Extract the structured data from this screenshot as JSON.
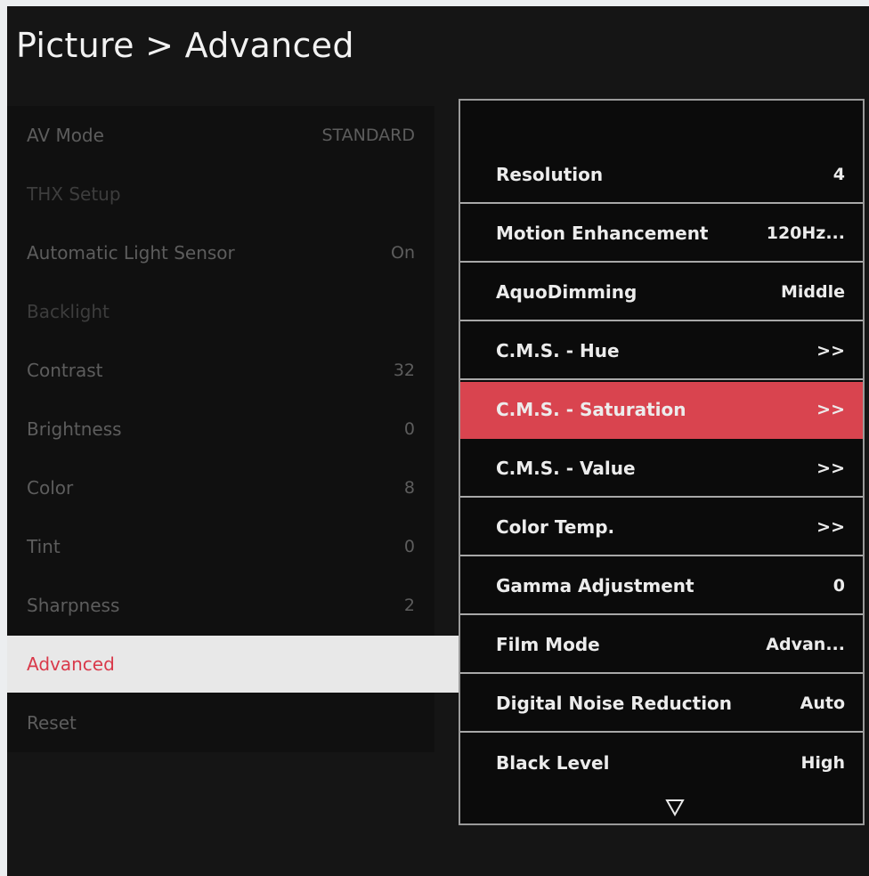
{
  "title": "Picture > Advanced",
  "left_menu": [
    {
      "label": "AV Mode",
      "value": "STANDARD"
    },
    {
      "label": "THX Setup",
      "value": ""
    },
    {
      "label": "Automatic Light Sensor",
      "value": "On"
    },
    {
      "label": "Backlight",
      "value": ""
    },
    {
      "label": "Contrast",
      "value": "32"
    },
    {
      "label": "Brightness",
      "value": "0"
    },
    {
      "label": "Color",
      "value": "8"
    },
    {
      "label": "Tint",
      "value": "0"
    },
    {
      "label": "Sharpness",
      "value": "2"
    },
    {
      "label": "Advanced",
      "value": ""
    },
    {
      "label": "Reset",
      "value": ""
    }
  ],
  "right_menu": [
    {
      "label": "Resolution",
      "value": "4"
    },
    {
      "label": "Motion Enhancement",
      "value": "120Hz..."
    },
    {
      "label": "AquoDimming",
      "value": "Middle"
    },
    {
      "label": "C.M.S. - Hue",
      "value": ">>"
    },
    {
      "label": "C.M.S. - Saturation",
      "value": ">>"
    },
    {
      "label": "C.M.S. - Value",
      "value": ">>"
    },
    {
      "label": "Color Temp.",
      "value": ">>"
    },
    {
      "label": "Gamma Adjustment",
      "value": "0"
    },
    {
      "label": "Film Mode",
      "value": "Advan..."
    },
    {
      "label": "Digital Noise Reduction",
      "value": "Auto"
    },
    {
      "label": "Black Level",
      "value": "High"
    }
  ],
  "colors": {
    "accent_red": "#d9444f",
    "selected_text_red": "#d9394a",
    "background": "#151515"
  },
  "icons": {
    "scroll_down": "triangle-down-outline-icon"
  }
}
